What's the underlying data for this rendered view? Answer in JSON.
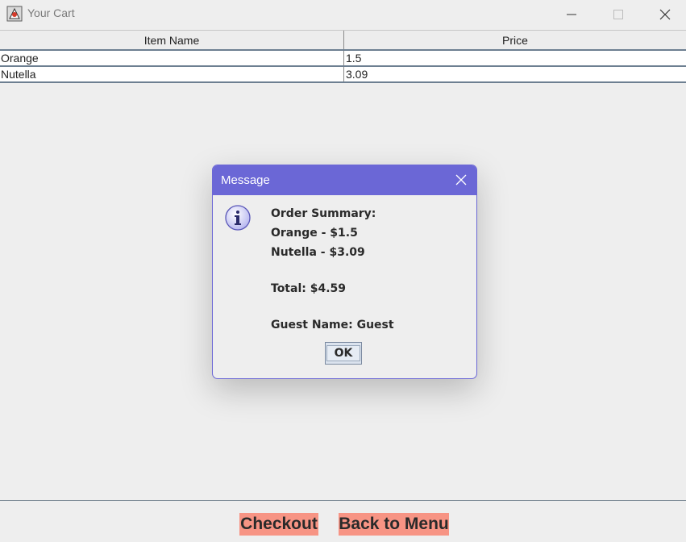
{
  "window": {
    "title": "Your Cart",
    "controls": [
      "minimize-icon",
      "maximize-icon",
      "close-icon"
    ]
  },
  "table": {
    "headers": [
      "Item Name",
      "Price"
    ],
    "rows": [
      [
        "Orange",
        "1.5"
      ],
      [
        "Nutella",
        "3.09"
      ]
    ]
  },
  "buttons": {
    "checkout": "Checkout",
    "back_to_menu": "Back to Menu"
  },
  "dialog": {
    "title": "Message",
    "lines": [
      "Order Summary:",
      "Orange - $1.5",
      "Nutella - $3.09",
      "Total: $4.59",
      "Guest Name: Guest"
    ],
    "ok_label": "OK"
  },
  "colors": {
    "dialog_header": "#6b67d6",
    "action_button": "#f79484",
    "background": "#eeeeee"
  }
}
